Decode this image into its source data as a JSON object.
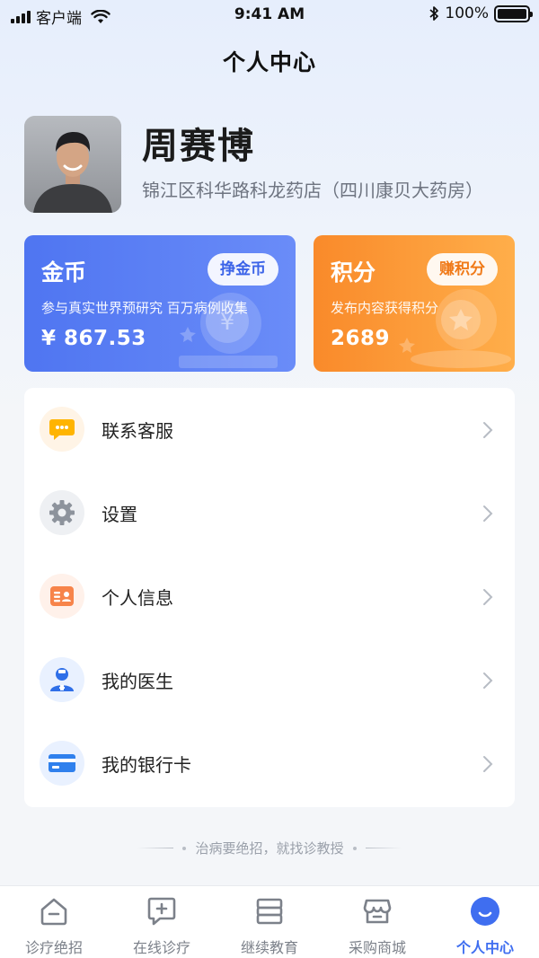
{
  "status_bar": {
    "carrier": "客户端",
    "time": "9:41 AM",
    "battery": "100%"
  },
  "header": {
    "title": "个人中心"
  },
  "profile": {
    "name": "周赛博",
    "store": "锦江区科华路科龙药店（四川康贝大药房）"
  },
  "coins_card": {
    "title": "金币",
    "button": "挣金币",
    "description": "参与真实世界预研究 百万病例收集",
    "amount": "¥ 867.53",
    "color": "#4f75f1"
  },
  "points_card": {
    "title": "积分",
    "button": "赚积分",
    "description": "发布内容获得积分",
    "amount": "2689",
    "color": "#f98a2a"
  },
  "menu": {
    "items": [
      {
        "label": "联系客服",
        "icon": "chat-bubble-icon"
      },
      {
        "label": "设置",
        "icon": "gear-icon"
      },
      {
        "label": "个人信息",
        "icon": "id-card-icon"
      },
      {
        "label": "我的医生",
        "icon": "doctor-icon"
      },
      {
        "label": "我的银行卡",
        "icon": "bank-card-icon"
      }
    ]
  },
  "slogan": "治病要绝招，就找诊教授",
  "tab_bar": {
    "active_color": "#3f6ef0",
    "tabs": [
      {
        "label": "诊疗绝招",
        "icon": "house-icon"
      },
      {
        "label": "在线诊疗",
        "icon": "chat-plus-icon"
      },
      {
        "label": "继续教育",
        "icon": "books-icon"
      },
      {
        "label": "采购商城",
        "icon": "store-icon"
      },
      {
        "label": "个人中心",
        "icon": "smile-icon",
        "active": true
      }
    ]
  }
}
